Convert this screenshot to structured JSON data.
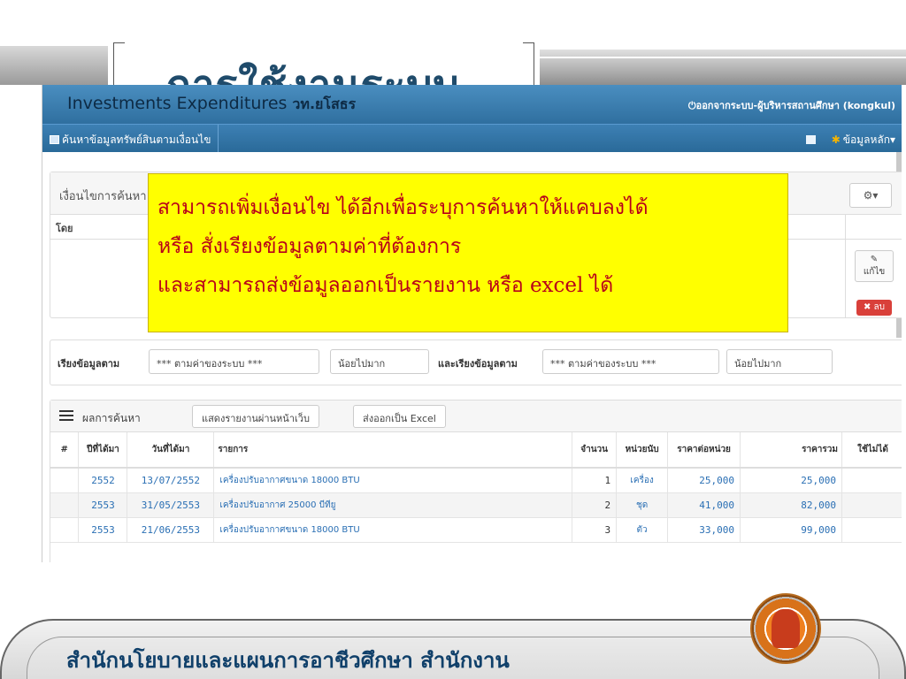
{
  "slide": {
    "title": "การใช้งานระบบ",
    "footer_text": "สำนักนโยบายและแผนการอาชีวศึกษา   สำนักงาน"
  },
  "app": {
    "title": "Investments Expenditures",
    "college": "วท.ยโสธร",
    "logout": "ออกจากระบบ-ผู้บริหารสถานศึกษา (kongkul)",
    "nav": {
      "search": "ค้นหาข้อมูลทรัพย์สินตามเงื่อนไข",
      "master": "ข้อมูลหลัก"
    }
  },
  "conditions": {
    "title": "เงื่อนไขการค้นหา",
    "column_by": "โดย",
    "edit_label": "แก้ไข",
    "delete_label": "ลบ"
  },
  "sort": {
    "label1": "เรียงข้อมูลตาม",
    "field1": "*** ตามค่าของระบบ ***",
    "order1": "น้อยไปมาก",
    "label2": "และเรียงข้อมูลตาม",
    "field2": "*** ตามค่าของระบบ ***",
    "order2": "น้อยไปมาก"
  },
  "results": {
    "title": "ผลการค้นหา",
    "web_report": "แสดงรายงานผ่านหน้าเว็บ",
    "export_excel": "ส่งออกเป็น Excel",
    "columns": [
      "#",
      "ปีที่ได้มา",
      "วันที่ได้มา",
      "รายการ",
      "จำนวน",
      "หน่วยนับ",
      "ราคาต่อหน่วย",
      "ราคารวม",
      "ใช้ไม่ได้"
    ],
    "rows": [
      {
        "year": "2552",
        "date": "13/07/2552",
        "item": "เครื่องปรับอากาศขนาด 18000 BTU",
        "qty": "1",
        "unit": "เครื่อง",
        "price": "25,000",
        "total": "25,000"
      },
      {
        "year": "2553",
        "date": "31/05/2553",
        "item": "เครื่องปรับอากาศ 25000 บีทียู",
        "qty": "2",
        "unit": "ชุด",
        "price": "41,000",
        "total": "82,000"
      },
      {
        "year": "2553",
        "date": "21/06/2553",
        "item": "เครื่องปรับอากาศขนาด 18000 BTU",
        "qty": "3",
        "unit": "ตัว",
        "price": "33,000",
        "total": "99,000"
      }
    ]
  },
  "callout": {
    "line1": "สามารถเพิ่มเงื่อนไข ได้อีกเพื่อระบุการค้นหาให้แคบลงได้",
    "line2": "หรือ สั่งเรียงข้อมูลตามค่าที่ต้องการ",
    "line3": "และสามารถส่งข้อมูลออกเป็นรายงาน หรือ excel ได้"
  },
  "colors": {
    "header_blue": "#3d80b4",
    "callout_yellow": "#ffff00",
    "callout_text": "#b8001a",
    "title_blue": "#1f4b6b"
  }
}
